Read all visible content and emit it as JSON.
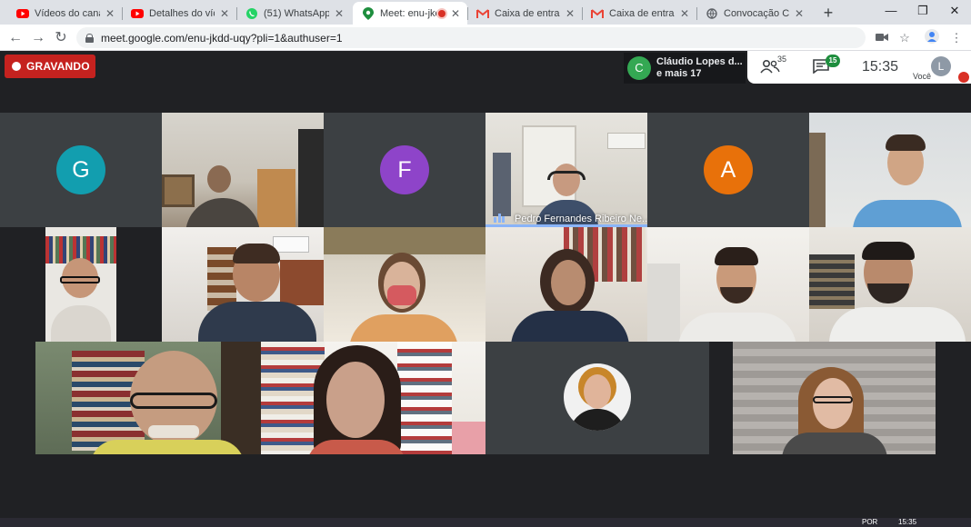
{
  "tabs": [
    {
      "title": "Vídeos do canal - ",
      "icon": "youtube-icon",
      "active": false
    },
    {
      "title": "Detalhes do vídeo ",
      "icon": "youtube-icon",
      "active": false
    },
    {
      "title": "(51) WhatsApp",
      "icon": "whatsapp-icon",
      "active": false
    },
    {
      "title": "Meet: enu-jkd",
      "icon": "meet-icon",
      "active": true,
      "recording": true
    },
    {
      "title": "Caixa de entrada (",
      "icon": "gmail-icon",
      "active": false
    },
    {
      "title": "Caixa de entrada (",
      "icon": "gmail-icon",
      "active": false
    },
    {
      "title": "Convocação CONS",
      "icon": "globe-icon",
      "active": false
    }
  ],
  "browser": {
    "url": "meet.google.com/enu-jkdd-uqy?pli=1&authuser=1"
  },
  "meet": {
    "recording_label": "GRAVANDO",
    "presenter_avatar_letter": "C",
    "presenter_line1": "Cláudio Lopes d...",
    "presenter_line2": "e mais 17",
    "people_count": "35",
    "chat_count": "15",
    "time": "15:35",
    "self_avatar_letter": "L",
    "self_label": "Você",
    "active_speaker_name": "Pedro Fernandes Ribeiro Ne...",
    "avatar_tiles": [
      {
        "letter": "G",
        "color": "#129eaf"
      },
      {
        "letter": "F",
        "color": "#8e44c9"
      },
      {
        "letter": "A",
        "color": "#e8710a"
      }
    ]
  },
  "taskbar": {
    "lang": "POR",
    "clock": "15:35"
  },
  "colors": {
    "meet_bg": "#202124",
    "recording_red": "#c5221f",
    "speaker_blue": "#8ab4f8"
  }
}
